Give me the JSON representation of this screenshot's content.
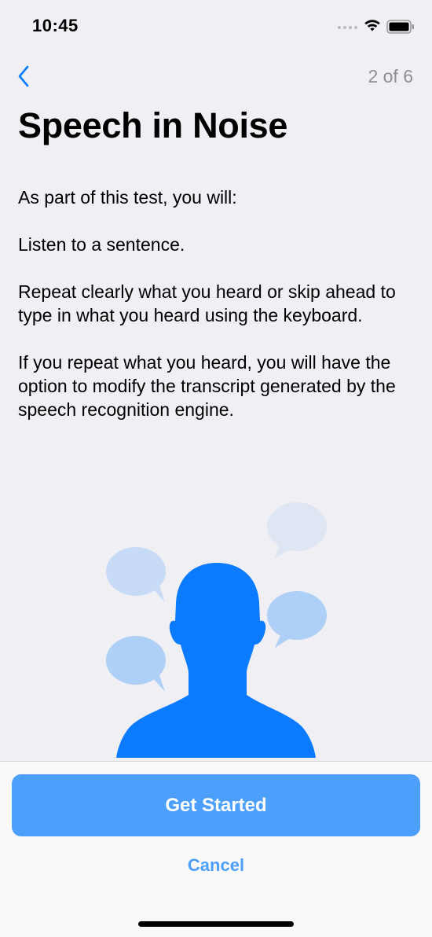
{
  "status_bar": {
    "time": "10:45",
    "signal_icon": "signal-dots-icon",
    "wifi_icon": "wifi-icon",
    "battery_icon": "battery-icon"
  },
  "nav": {
    "back_icon": "chevron-left-icon",
    "step_counter": "2 of 6"
  },
  "title": "Speech in Noise",
  "body": {
    "paragraphs": [
      "As part of this test, you will:",
      "Listen to a sentence.",
      "Repeat clearly what you heard or skip ahead to type in what you heard using the keyboard.",
      "If you repeat what you heard, you will have the option to modify the transcript generated by the speech recognition engine."
    ]
  },
  "illustration": {
    "icon": "person-with-speech-bubbles-icon"
  },
  "footer": {
    "primary_label": "Get Started",
    "cancel_label": "Cancel"
  },
  "colors": {
    "accent": "#4c9ffa",
    "figure": "#0a7aff",
    "background": "#efeff4"
  }
}
